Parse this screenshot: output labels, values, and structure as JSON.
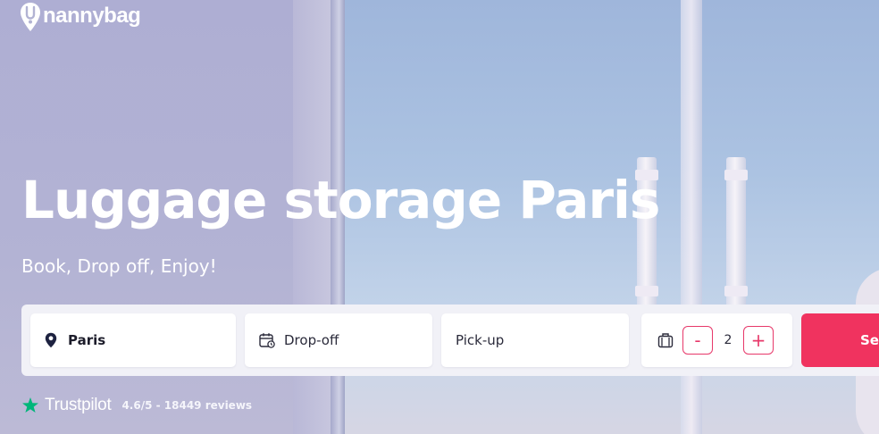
{
  "brand": {
    "name": "nannybag"
  },
  "hero": {
    "title": "Luggage storage Paris",
    "subtitle": "Book, Drop off, Enjoy!"
  },
  "search": {
    "location_value": "Paris",
    "dropoff_label": "Drop-off",
    "pickup_label": "Pick-up",
    "bags_count": "2",
    "minus_label": "-",
    "plus_label": "+",
    "search_label": "Search"
  },
  "trust": {
    "name": "Trustpilot",
    "rating_text": "4.6/5 - 18449 reviews"
  },
  "icons": {
    "location": "location-pin-icon",
    "calendar": "calendar-icon",
    "luggage": "luggage-icon",
    "star": "star-icon"
  },
  "colors": {
    "accent": "#f0335f",
    "stepper": "#e7386a",
    "trustpilot_green": "#00b67a",
    "text_dark": "#1d1d2b"
  }
}
